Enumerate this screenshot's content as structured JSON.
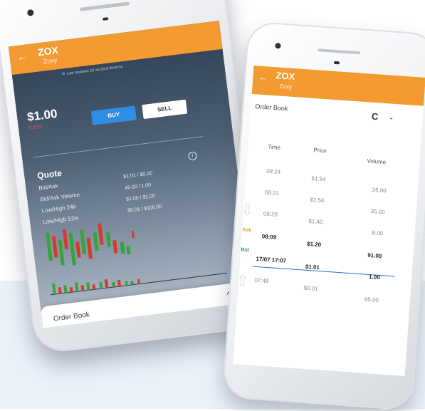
{
  "left_phone": {
    "app_bar": {
      "back": "←",
      "symbol": "ZOX",
      "name": "Zoxy"
    },
    "last_updated": "Last Updated: 18 Jul 2019 09:08:54",
    "price": "$1.00",
    "change": "0.00%",
    "buy_label": "BUY",
    "sell_label": "SELL",
    "quote": {
      "title": "Quote",
      "info_icon": "info-icon",
      "rows": [
        {
          "label": "Bid/Ask",
          "value": "$1.01 / $0.00"
        },
        {
          "label": "Bid/Ask Volume",
          "value": "49.00 / 1.00"
        },
        {
          "label": "Low/High 24h",
          "value": "$1.00 / $1.00"
        },
        {
          "label": "Low/High 52w",
          "value": "$0.01 / $100.00"
        }
      ]
    },
    "order_book": {
      "label": "Order Book",
      "caret": "^"
    },
    "colors": {
      "accent": "#f39a30",
      "buy": "#2f8fe6",
      "up": "#3aa23a",
      "down": "#d33a2c"
    }
  },
  "right_phone": {
    "app_bar": {
      "back": "←",
      "symbol": "ZOX",
      "name": "Zoxy"
    },
    "order_book": {
      "title": "Order Book",
      "refresh_icon": "C",
      "dropdown_icon": "⌄",
      "headers": {
        "time": "Time",
        "price": "Price",
        "volume": "Volume"
      },
      "asks": [
        {
          "time": "08:24",
          "price": "$1.54",
          "volume": "26.00"
        },
        {
          "time": "08:21",
          "price": "$1.50",
          "volume": "35.00"
        },
        {
          "time": "08:28",
          "price": "$1.40",
          "volume": "8.00"
        },
        {
          "time": "08:09",
          "price": "$1.20",
          "volume": "91.00"
        }
      ],
      "bids": [
        {
          "time": "17/07 17:07",
          "price": "$1.01",
          "volume": "1.00"
        },
        {
          "time": "07:48",
          "price": "$0.01",
          "volume": "95.00"
        }
      ],
      "ask_label": "Ask",
      "bid_label": "Bid",
      "ask_color": "#f39a30",
      "bid_color": "#3aa23a"
    }
  }
}
